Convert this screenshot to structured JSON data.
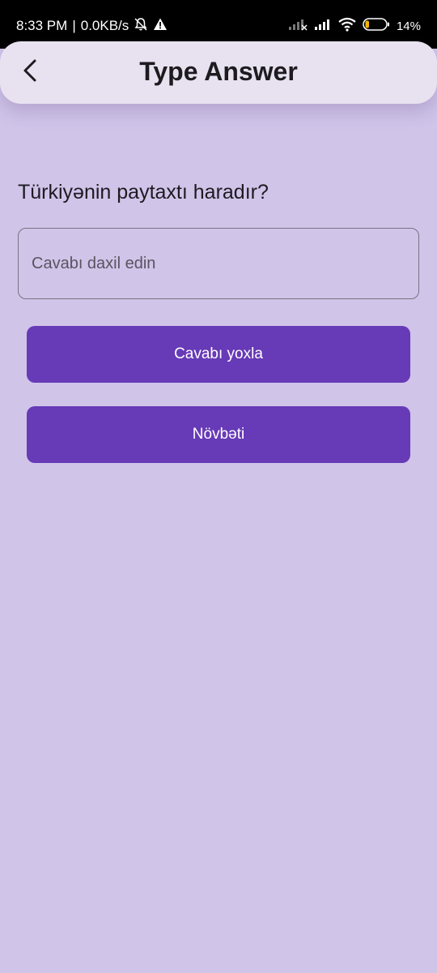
{
  "status_bar": {
    "time": "8:33 PM",
    "separator": "|",
    "network_speed": "0.0KB/s",
    "battery_percent": "14%",
    "icons": [
      "bell-off-icon",
      "warning-icon",
      "signal-icon",
      "signal-icon",
      "wifi-icon",
      "battery-icon"
    ]
  },
  "app_bar": {
    "title": "Type Answer",
    "back_icon": "chevron-left-icon"
  },
  "question": {
    "text": "Türkiyənin paytaxtı haradır?"
  },
  "answer_input": {
    "value": "",
    "placeholder": "Cavabı daxil edin"
  },
  "buttons": {
    "check_label": "Cavabı yoxla",
    "next_label": "Növbəti"
  },
  "colors": {
    "background": "#d0c4e9",
    "app_bar": "#e8e2f0",
    "primary": "#673ab7",
    "status_bar": "#000000"
  }
}
